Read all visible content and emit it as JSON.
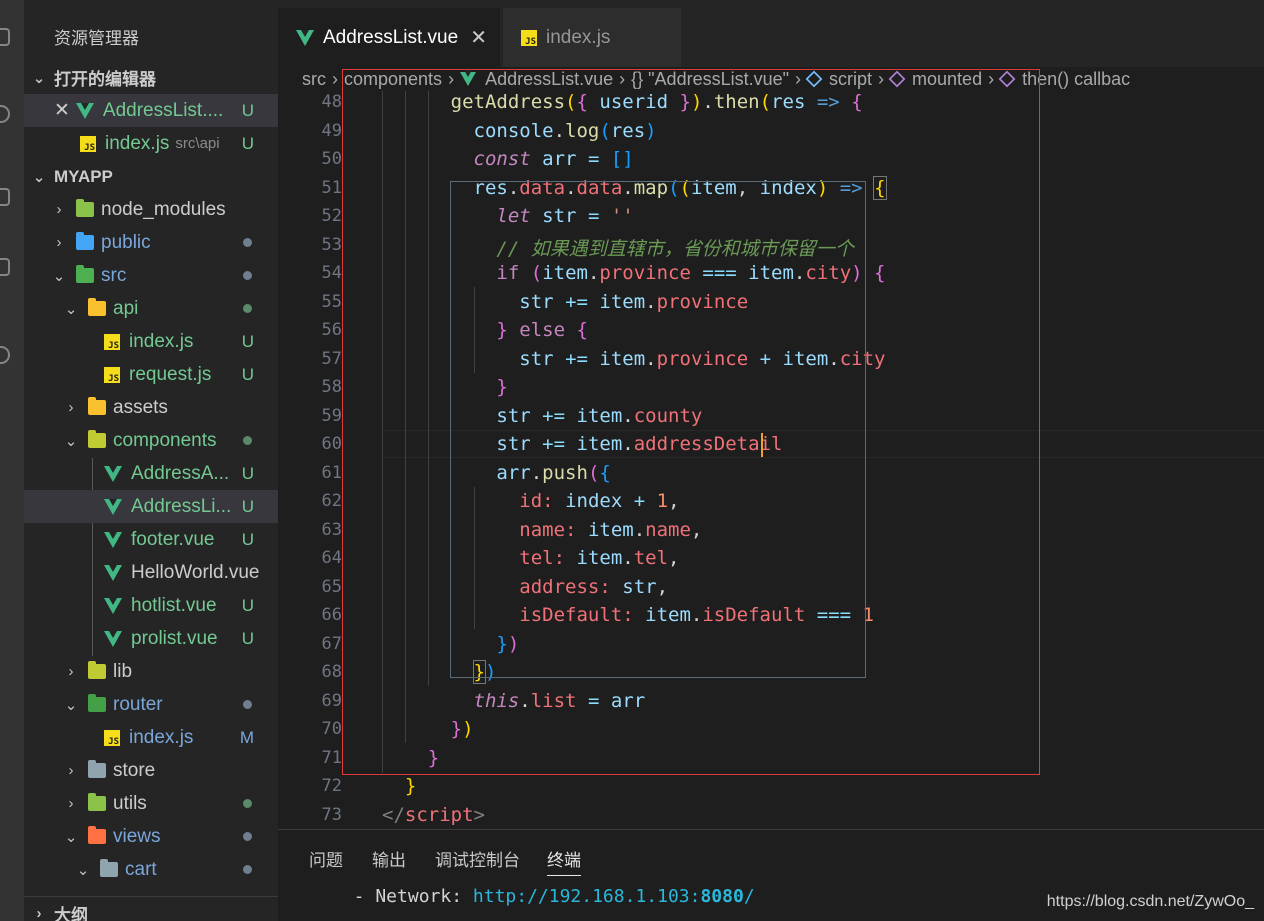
{
  "explorer": {
    "title": "资源管理器",
    "open_editors_label": "打开的编辑器",
    "open_editors": [
      {
        "name": "AddressList....",
        "badge": "U"
      },
      {
        "name": "index.js",
        "path": "src\\api",
        "badge": "U"
      }
    ],
    "project_label": "MYAPP",
    "tree": [
      {
        "name": "node_modules"
      },
      {
        "name": "public"
      },
      {
        "name": "src"
      },
      {
        "name": "api"
      },
      {
        "name": "index.js",
        "badge": "U"
      },
      {
        "name": "request.js",
        "badge": "U"
      },
      {
        "name": "assets"
      },
      {
        "name": "components"
      },
      {
        "name": "AddressA...",
        "badge": "U"
      },
      {
        "name": "AddressLi...",
        "badge": "U"
      },
      {
        "name": "footer.vue",
        "badge": "U"
      },
      {
        "name": "HelloWorld.vue"
      },
      {
        "name": "hotlist.vue",
        "badge": "U"
      },
      {
        "name": "prolist.vue",
        "badge": "U"
      },
      {
        "name": "lib"
      },
      {
        "name": "router"
      },
      {
        "name": "index.js",
        "badge": "M"
      },
      {
        "name": "store"
      },
      {
        "name": "utils"
      },
      {
        "name": "views"
      },
      {
        "name": "cart"
      }
    ],
    "outline_label": "大纲"
  },
  "tabs": [
    {
      "label": "AddressList.vue",
      "close": "✕"
    },
    {
      "label": "index.js"
    }
  ],
  "breadcrumb": [
    "src",
    "components",
    "AddressList.vue",
    "{} \"AddressList.vue\"",
    "script",
    "mounted",
    "then() callbac"
  ],
  "editor": {
    "line_numbers": [
      "48",
      "49",
      "50",
      "51",
      "52",
      "53",
      "54",
      "55",
      "56",
      "57",
      "58",
      "59",
      "60",
      "61",
      "62",
      "63",
      "64",
      "65",
      "66",
      "67",
      "68",
      "69",
      "70",
      "71",
      "72",
      "73"
    ],
    "comment_line": "// 如果遇到直辖市，省份和城市保留一个"
  },
  "panel": {
    "tabs": [
      "问题",
      "输出",
      "调试控制台",
      "终端"
    ],
    "terminal_prefix": "  - Network: ",
    "terminal_url": "http://192.168.1.103:",
    "terminal_port": "8080",
    "terminal_suffix": "/"
  },
  "watermark": "https://blog.csdn.net/ZywOo_",
  "colors": {
    "accent_untracked": "#73c991",
    "accent_modified": "#e2c08d",
    "highlight_box": "#e03a3a"
  }
}
